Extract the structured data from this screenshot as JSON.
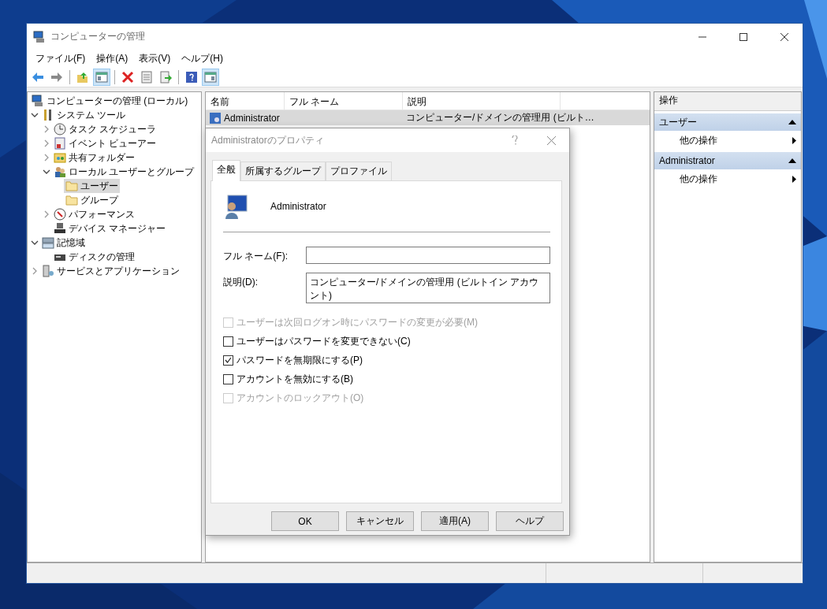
{
  "window": {
    "title": "コンピューターの管理"
  },
  "menu": [
    "ファイル(F)",
    "操作(A)",
    "表示(V)",
    "ヘルプ(H)"
  ],
  "toolbar": [
    {
      "kind": "button",
      "pressed": false
    },
    {
      "kind": "button",
      "pressed": false
    },
    {
      "kind": "separator"
    },
    {
      "kind": "button",
      "pressed": false
    },
    {
      "kind": "button",
      "pressed": true
    },
    {
      "kind": "separator"
    },
    {
      "kind": "button",
      "pressed": false
    },
    {
      "kind": "button",
      "pressed": false
    },
    {
      "kind": "button",
      "pressed": false
    },
    {
      "kind": "separator"
    },
    {
      "kind": "button",
      "pressed": false
    },
    {
      "kind": "button",
      "pressed": true
    }
  ],
  "tree": [
    {
      "label": "コンピューターの管理 (ローカル)",
      "selected": false,
      "children": [
        {
          "label": "システム ツール",
          "selected": false,
          "expanded": true,
          "children": [
            {
              "label": "タスク スケジューラ",
              "selected": false,
              "expanded": false
            },
            {
              "label": "イベント ビューアー",
              "selected": false,
              "expanded": false
            },
            {
              "label": "共有フォルダー",
              "selected": false,
              "expanded": false
            },
            {
              "label": "ローカル ユーザーとグループ",
              "selected": false,
              "expanded": true,
              "children": [
                {
                  "label": "ユーザー",
                  "selected": true
                },
                {
                  "label": "グループ",
                  "selected": false
                }
              ]
            },
            {
              "label": "パフォーマンス",
              "selected": false,
              "expanded": false
            },
            {
              "label": "デバイス マネージャー",
              "selected": false
            }
          ]
        },
        {
          "label": "記憶域",
          "selected": false,
          "expanded": true,
          "children": [
            {
              "label": "ディスクの管理",
              "selected": false
            }
          ]
        },
        {
          "label": "サービスとアプリケーション",
          "selected": false,
          "expanded": false
        }
      ]
    }
  ],
  "list": {
    "columns": [
      "名前",
      "フル ネーム",
      "説明"
    ],
    "rows": [
      {
        "name": "Administrator",
        "description": "コンピューター/ドメインの管理用 (ビルト…",
        "selected": true
      }
    ]
  },
  "actions": {
    "title": "操作",
    "sections": [
      {
        "title": "ユーザー",
        "expanded": true,
        "items": [
          "他の操作"
        ]
      },
      {
        "title": "Administrator",
        "expanded": true,
        "items": [
          "他の操作"
        ]
      }
    ]
  },
  "dialog": {
    "title": "Administratorのプロパティ",
    "tabs": [
      {
        "label": "全般",
        "selected": true
      },
      {
        "label": "所属するグループ",
        "selected": false
      },
      {
        "label": "プロファイル",
        "selected": false
      }
    ],
    "user_name": "Administrator",
    "fields": [
      {
        "kind": "text",
        "label": "フル ネーム(F):"
      },
      {
        "kind": "multiline",
        "label": "説明(D):",
        "value": "コンピューター/ドメインの管理用 (ビルトイン アカウント)"
      }
    ],
    "checkboxes": [
      {
        "label": "ユーザーは次回ログオン時にパスワードの変更が必要(M)",
        "checked": false,
        "disabled": true
      },
      {
        "label": "ユーザーはパスワードを変更できない(C)",
        "checked": false,
        "disabled": false
      },
      {
        "label": "パスワードを無期限にする(P)",
        "checked": true,
        "disabled": false
      },
      {
        "label": "アカウントを無効にする(B)",
        "checked": false,
        "disabled": false
      },
      {
        "label": "アカウントのロックアウト(O)",
        "checked": false,
        "disabled": true
      }
    ],
    "buttons": [
      "OK",
      "キャンセル",
      "適用(A)",
      "ヘルプ"
    ]
  }
}
